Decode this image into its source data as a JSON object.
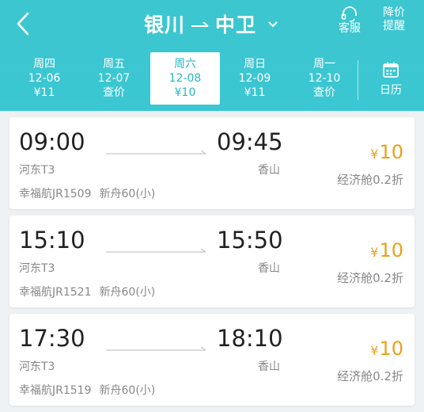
{
  "header": {
    "from": "银川",
    "to": "中卫",
    "service_label": "客服",
    "price_alert_line1": "降价",
    "price_alert_line2": "提醒"
  },
  "date_tabs": [
    {
      "weekday": "周四",
      "date": "12-06",
      "price": "¥11",
      "selected": false
    },
    {
      "weekday": "周五",
      "date": "12-07",
      "price": "查价",
      "selected": false
    },
    {
      "weekday": "周六",
      "date": "12-08",
      "price": "¥10",
      "selected": true
    },
    {
      "weekday": "周日",
      "date": "12-09",
      "price": "¥11",
      "selected": false
    },
    {
      "weekday": "周一",
      "date": "12-10",
      "price": "查价",
      "selected": false
    }
  ],
  "calendar_label": "日历",
  "flights": [
    {
      "dep_time": "09:00",
      "arr_time": "09:45",
      "dep_airport": "河东T3",
      "arr_airport": "香山",
      "flight_no": "幸福航JR1509",
      "aircraft": "新舟60(小)",
      "currency": "¥",
      "price": "10",
      "cabin": "经济舱0.2折"
    },
    {
      "dep_time": "15:10",
      "arr_time": "15:50",
      "dep_airport": "河东T3",
      "arr_airport": "香山",
      "flight_no": "幸福航JR1521",
      "aircraft": "新舟60(小)",
      "currency": "¥",
      "price": "10",
      "cabin": "经济舱0.2折"
    },
    {
      "dep_time": "17:30",
      "arr_time": "18:10",
      "dep_airport": "河东T3",
      "arr_airport": "香山",
      "flight_no": "幸福航JR1519",
      "aircraft": "新舟60(小)",
      "currency": "¥",
      "price": "10",
      "cabin": "经济舱0.2折"
    }
  ],
  "colors": {
    "header_bg": "#3cc6cf",
    "selected_text": "#27b7c6",
    "price": "#e8a21b"
  }
}
